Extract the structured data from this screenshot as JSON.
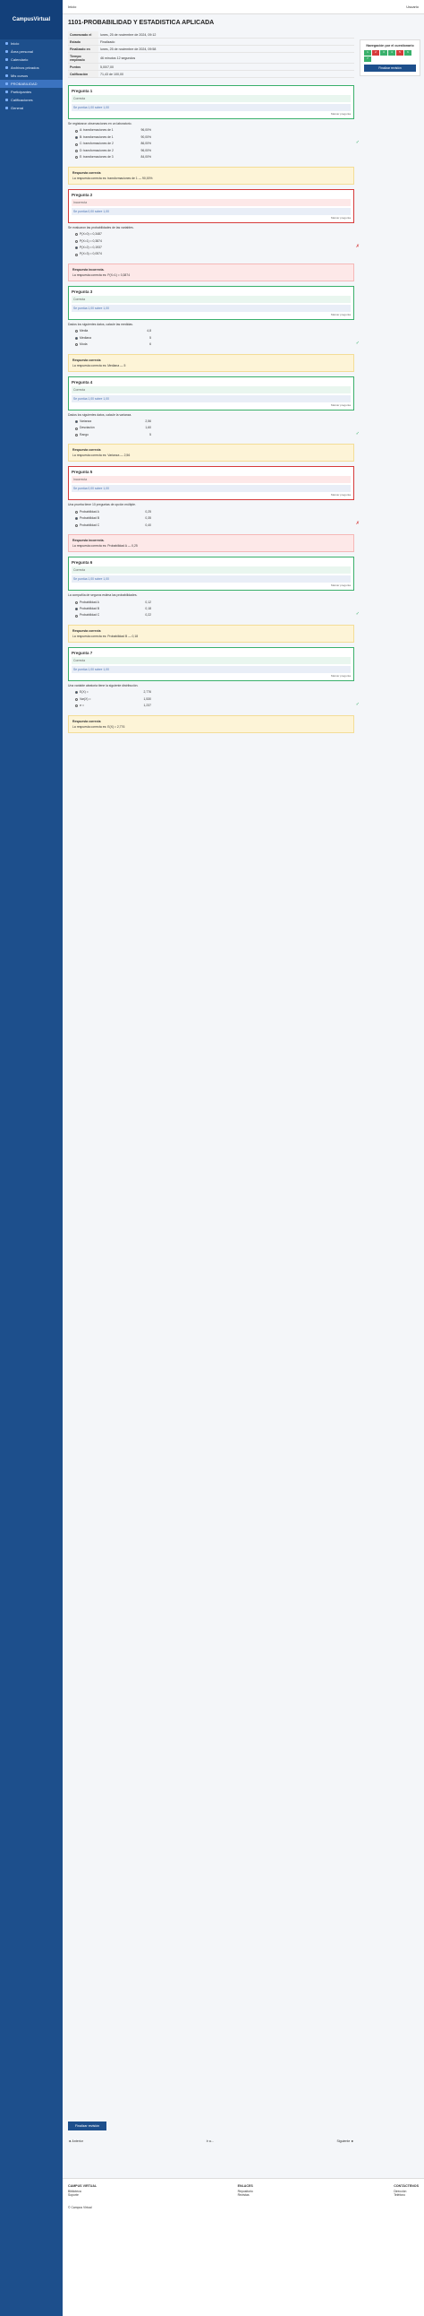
{
  "app": {
    "logo": "CampusVirtual",
    "topbar_title": "Inicio",
    "user": "Usuario"
  },
  "sidebar": {
    "items": [
      {
        "label": "Inicio"
      },
      {
        "label": "Área personal"
      },
      {
        "label": "Calendario"
      },
      {
        "label": "Archivos privados"
      },
      {
        "label": "Mis cursos"
      },
      {
        "label": "PROBABILIDAD"
      },
      {
        "label": "Participantes"
      },
      {
        "label": "Calificaciones"
      },
      {
        "label": "General"
      }
    ]
  },
  "page": {
    "title": "1101-PROBABILIDAD Y ESTADISTICA APLICADA",
    "summary": [
      {
        "k": "Comenzado el",
        "v": "lunes, 25 de noviembre de 2024, 09:12"
      },
      {
        "k": "Estado",
        "v": "Finalizado"
      },
      {
        "k": "Finalizado en",
        "v": "lunes, 25 de noviembre de 2024, 09:58"
      },
      {
        "k": "Tiempo empleado",
        "v": "46 minutos 12 segundos"
      },
      {
        "k": "Puntos",
        "v": "5,00/7,00"
      },
      {
        "k": "Calificación",
        "v": "71,43 de 100,00"
      }
    ]
  },
  "questions": [
    {
      "title": "Pregunta 1",
      "status": "Correcta",
      "grade": "Se puntúa 1,00 sobre 1,00",
      "flag": "Marcar pregunta",
      "correct": true,
      "prompt": "Se registraron observaciones en un laboratorio.",
      "options": [
        {
          "txt": "A: transformaciones de 1",
          "val": "96,00%",
          "sel": false
        },
        {
          "txt": "B: transformaciones de 1",
          "val": "90,00%",
          "sel": true
        },
        {
          "txt": "C: transformaciones de 2",
          "val": "86,00%",
          "sel": false
        },
        {
          "txt": "D: transformaciones de 2",
          "val": "96,00%",
          "sel": false
        },
        {
          "txt": "E: transformaciones de 3",
          "val": "84,00%",
          "sel": false
        }
      ],
      "feedback_title": "Respuesta correcta",
      "feedback": "La respuesta correcta es: transformaciones de 1 — 90,00%"
    },
    {
      "title": "Pregunta 2",
      "status": "Incorrecta",
      "grade": "Se puntúa 0,00 sobre 1,00",
      "flag": "Marcar pregunta",
      "correct": false,
      "prompt": "Se evaluaron las probabilidades de las variables.",
      "options": [
        {
          "txt": "P(X=0) = 0,3487",
          "val": "",
          "sel": false
        },
        {
          "txt": "P(X=1) = 0,3874",
          "val": "",
          "sel": false
        },
        {
          "txt": "P(X=2) = 0,1937",
          "val": "",
          "sel": true
        },
        {
          "txt": "P(X=3) = 0,0574",
          "val": "",
          "sel": false
        }
      ],
      "feedback_title": "Respuesta incorrecta.",
      "feedback": "La respuesta correcta es: P(X=1) = 0,3874"
    },
    {
      "title": "Pregunta 3",
      "status": "Correcta",
      "grade": "Se puntúa 1,00 sobre 1,00",
      "flag": "Marcar pregunta",
      "correct": true,
      "prompt": "Dados los siguientes datos, calcule las medidas.",
      "options": [
        {
          "txt": "Media",
          "val": "4,8",
          "sel": false
        },
        {
          "txt": "Mediana",
          "val": "5",
          "sel": true
        },
        {
          "txt": "Moda",
          "val": "6",
          "sel": false
        }
      ],
      "feedback_title": "Respuesta correcta",
      "feedback": "La respuesta correcta es: Mediana — 5"
    },
    {
      "title": "Pregunta 4",
      "status": "Correcta",
      "grade": "Se puntúa 1,00 sobre 1,00",
      "flag": "Marcar pregunta",
      "correct": true,
      "prompt": "Dados los siguientes datos, calcule la varianza.",
      "options": [
        {
          "txt": "Varianza",
          "val": "2,56",
          "sel": true
        },
        {
          "txt": "Desviación",
          "val": "1,60",
          "sel": false
        },
        {
          "txt": "Rango",
          "val": "5",
          "sel": false
        }
      ],
      "feedback_title": "Respuesta correcta",
      "feedback": "La respuesta correcta es: Varianza — 2,56"
    },
    {
      "title": "Pregunta 5",
      "status": "Incorrecta",
      "grade": "Se puntúa 0,00 sobre 1,00",
      "flag": "Marcar pregunta",
      "correct": false,
      "prompt": "Una prueba tiene 10 preguntas de opción múltiple.",
      "options": [
        {
          "txt": "Probabilidad A",
          "val": "0,25",
          "sel": false
        },
        {
          "txt": "Probabilidad B",
          "val": "0,35",
          "sel": true
        },
        {
          "txt": "Probabilidad C",
          "val": "0,40",
          "sel": false
        }
      ],
      "feedback_title": "Respuesta incorrecta.",
      "feedback": "La respuesta correcta es: Probabilidad A — 0,25"
    },
    {
      "title": "Pregunta 6",
      "status": "Correcta",
      "grade": "Se puntúa 1,00 sobre 1,00",
      "flag": "Marcar pregunta",
      "correct": true,
      "prompt": "La compañía de seguros estima las probabilidades.",
      "options": [
        {
          "txt": "Probabilidad A",
          "val": "0,12",
          "sel": false
        },
        {
          "txt": "Probabilidad B",
          "val": "0,18",
          "sel": true
        },
        {
          "txt": "Probabilidad C",
          "val": "0,22",
          "sel": false
        }
      ],
      "feedback_title": "Respuesta correcta",
      "feedback": "La respuesta correcta es: Probabilidad B — 0,18"
    },
    {
      "title": "Pregunta 7",
      "status": "Correcta",
      "grade": "Se puntúa 1,00 sobre 1,00",
      "flag": "Marcar pregunta",
      "correct": true,
      "prompt": "Una variable aleatoria tiene la siguiente distribución.",
      "options": [
        {
          "txt": "E(X) =",
          "val": "2,776",
          "sel": true
        },
        {
          "txt": "Var(X) =",
          "val": "1,530",
          "sel": false
        },
        {
          "txt": "σ =",
          "val": "1,237",
          "sel": false
        }
      ],
      "feedback_title": "Respuesta correcta",
      "feedback": "La respuesta correcta es: E(X) = 2,776"
    }
  ],
  "nav_panel": {
    "title": "Navegación por el cuestionario",
    "numbers": [
      "1",
      "2",
      "3",
      "4",
      "5",
      "6",
      "7"
    ],
    "finish": "Finalizar revisión"
  },
  "bottom": {
    "finish_review": "Finalizar revisión",
    "prev": "◄ Anterior",
    "jump": "Ir a...",
    "next": "Siguiente ►"
  },
  "footer": {
    "col1_title": "CAMPUS VIRTUAL",
    "col1_items": [
      "Biblioteca",
      "Soporte"
    ],
    "col2_title": "ENLACES",
    "col2_items": [
      "Repositorio",
      "Revistas"
    ],
    "col3_title": "CONTÁCTENOS",
    "col3_items": [
      "Dirección",
      "Teléfono"
    ],
    "brand": "© Campus Virtual"
  }
}
